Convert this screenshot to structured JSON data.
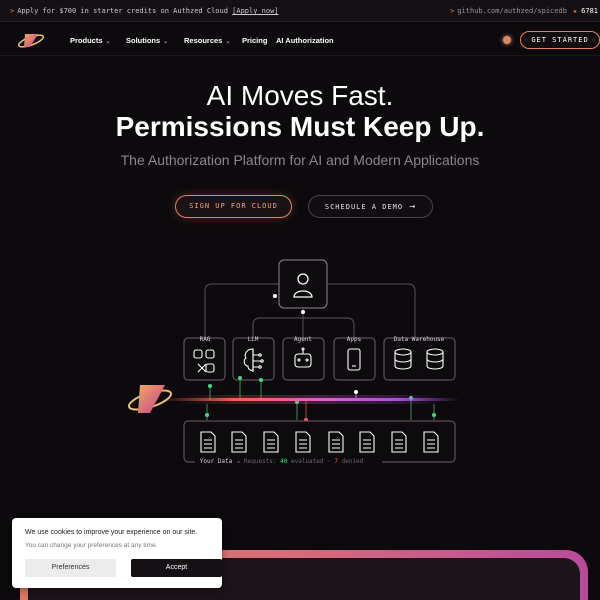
{
  "announcement": {
    "text": "Apply for $700 in starter credits on Authzed Cloud",
    "link": "[Apply now]",
    "repo": "github.com/authzed/spicedb",
    "stars": "6781"
  },
  "nav": {
    "items": [
      "Products",
      "Solutions",
      "Resources",
      "Pricing",
      "AI Authorization"
    ],
    "cta": "GET STARTED"
  },
  "hero": {
    "line1": "AI Moves Fast.",
    "line2": "Permissions Must Keep Up.",
    "subtitle": "The Authorization Platform for AI and Modern Applications",
    "primary_cta": "SIGN UP FOR CLOUD",
    "secondary_cta": "SCHEDULE A DEMO"
  },
  "diagram": {
    "nodes": [
      "RAG",
      "LLM",
      "Agent",
      "Apps",
      "Data Warehouse"
    ],
    "data_label": "Your Data",
    "requests_label": "Requests:",
    "evaluated_count": "40",
    "evaluated_label": "evaluated",
    "denied_count": "7",
    "denied_label": "denied",
    "colors": {
      "allowed": "#3ddc84",
      "denied": "#ff5a5a",
      "accent": "#e8815a"
    }
  },
  "cookie": {
    "title": "We use cookies to improve your experience on our site.",
    "body": "You can change your preferences at any time.",
    "preferences": "Preferences",
    "accept": "Accept"
  }
}
